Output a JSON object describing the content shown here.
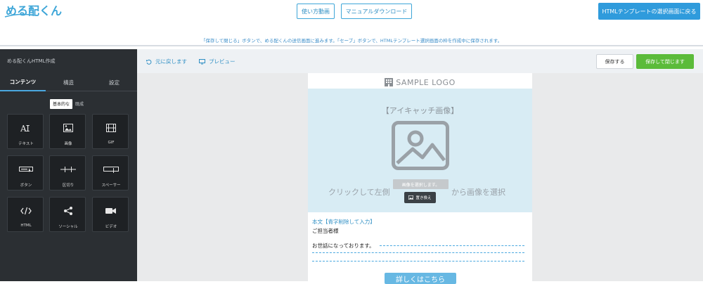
{
  "app": {
    "logo_text": "める配くん"
  },
  "header": {
    "how_to_video": "使い方動画",
    "manual_download": "マニュアルダウンロード",
    "back_to_template_select": "HTMLテンプレートの選択画面に戻る",
    "notice": "「保存して閉じる」ボタンで、める配くんの送信画面に進みます。「セーブ」ボタンで、HTMLテンプレート選択画面の枠を作成中に保存されます。"
  },
  "sidebar": {
    "title": "める配くんHTML作成",
    "tabs": [
      {
        "label": "コンテンツ",
        "active": true
      },
      {
        "label": "構造",
        "active": false
      },
      {
        "label": "設定",
        "active": false
      }
    ],
    "toggle": {
      "basic": "基本的な",
      "composite": "既成"
    },
    "items": [
      {
        "label": "テキスト",
        "icon": "text-icon"
      },
      {
        "label": "画像",
        "icon": "image-icon"
      },
      {
        "label": "GIF",
        "icon": "gif-film-icon"
      },
      {
        "label": "ボタン",
        "icon": "button-icon"
      },
      {
        "label": "区切り",
        "icon": "divider-icon"
      },
      {
        "label": "スペーサー",
        "icon": "spacer-icon"
      },
      {
        "label": "HTML",
        "icon": "code-icon"
      },
      {
        "label": "ソーシャル",
        "icon": "share-icon"
      },
      {
        "label": "ビデオ",
        "icon": "video-icon"
      }
    ]
  },
  "toolbar": {
    "undo": "元に戻します",
    "preview": "プレビュー",
    "save": "保存する",
    "save_and_close": "保存して閉じます"
  },
  "email": {
    "sample_logo": "SAMPLE LOGO",
    "hero_title": "【アイキャッチ画像】",
    "hero_left_text": "クリックして左側",
    "hero_right_text": "から画像を選択",
    "select_image": "画像を選択します。",
    "replace_image": "置き換え",
    "body_label": "本文【青字削除して入力】",
    "greeting": "ご担当者様",
    "intro": "お世話になっております。",
    "cta": "詳しくはこちら"
  },
  "colors": {
    "accent": "#2f9bdc",
    "save_close_green": "#5bbb3a",
    "sidebar_bg": "#2b2f33",
    "hero_bg": "#d8ecf4"
  }
}
